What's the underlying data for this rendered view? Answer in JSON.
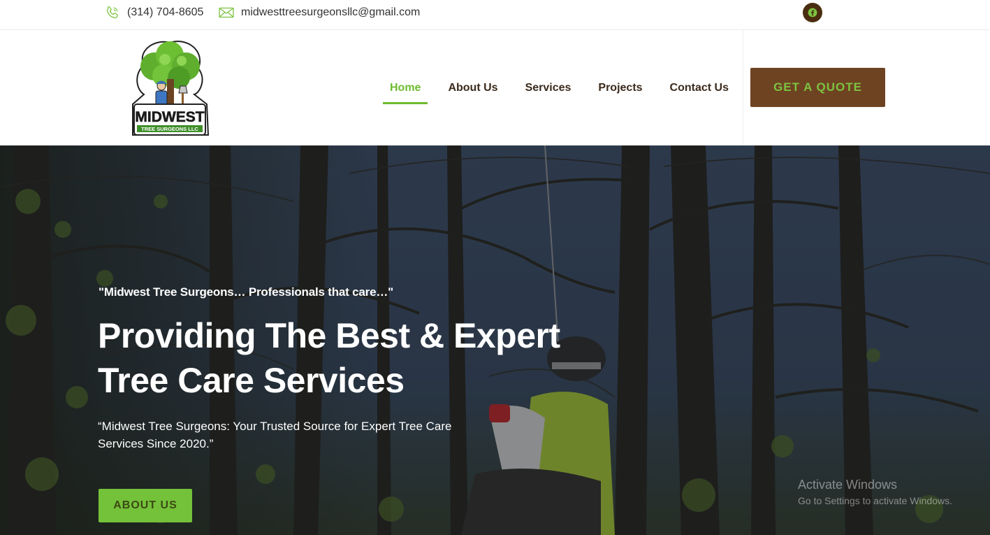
{
  "topbar": {
    "phone": "(314) 704-8605",
    "email": "midwesttreesurgeonsllc@gmail.com",
    "phone_icon": "phone-icon",
    "email_icon": "envelope-icon",
    "social_icon": "facebook-icon"
  },
  "header": {
    "logo": {
      "line1": "MIDWEST",
      "line2": "TREE SURGEONS LLC"
    },
    "nav": [
      {
        "label": "Home",
        "active": true
      },
      {
        "label": "About Us"
      },
      {
        "label": "Services"
      },
      {
        "label": "Projects"
      },
      {
        "label": "Contact Us"
      }
    ],
    "cta_label": "GET A QUOTE"
  },
  "hero": {
    "tagline": "\"Midwest Tree Surgeons… Professionals that care…\"",
    "headline": "Providing The Best & Expert Tree Care Services",
    "subtext": "“Midwest Tree Surgeons: Your Trusted Source for Expert Tree Care Services Since 2020.”",
    "button_label": "ABOUT US"
  },
  "watermark": {
    "line1": "Activate Windows",
    "line2": "Go to Settings to activate Windows."
  },
  "colors": {
    "accent_green": "#6dbb2f",
    "brand_brown": "#6e4322",
    "text_dark": "#3b2a1c"
  }
}
